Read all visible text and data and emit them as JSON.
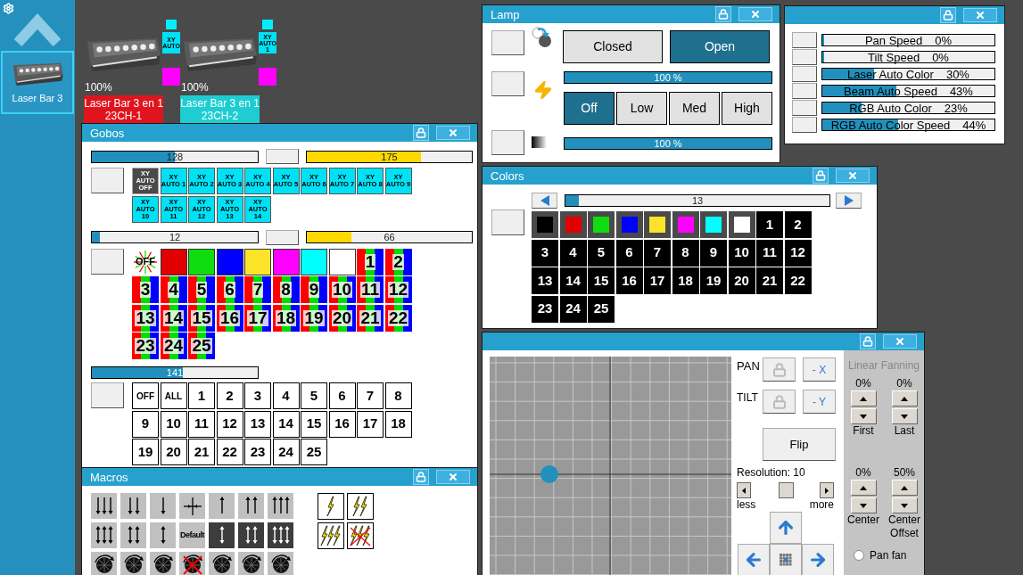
{
  "sidebar": {
    "items": [
      {
        "label": "Laser Bar 3",
        "selected": true
      }
    ]
  },
  "stage": {
    "fixtures": [
      {
        "name": "Laser Bar 3 en 1 23CH-1",
        "reading": "100%",
        "color": "#e0141e",
        "badge": "XY AUTO"
      },
      {
        "name": "Laser Bar 3 en 1 23CH-2",
        "reading": "100%",
        "color": "#1ecdd2",
        "badge": "XY AUTO 1"
      }
    ]
  },
  "gobos": {
    "title": "Gobos",
    "sections": [
      {
        "sliders": [
          {
            "value": "128",
            "level": 0.5,
            "color": "#2190bd"
          },
          {
            "value": "175",
            "level": 0.69,
            "color": "#ffd800"
          }
        ],
        "tiles": [
          {
            "kind": "xy",
            "label": "XY AUTO OFF",
            "selected": true
          },
          {
            "kind": "xy",
            "label": "XY AUTO 1",
            "selected": false
          },
          {
            "kind": "xy",
            "label": "XY AUTO 2",
            "selected": false
          },
          {
            "kind": "xy",
            "label": "XY AUTO 3",
            "selected": false
          },
          {
            "kind": "xy",
            "label": "XY AUTO 4",
            "selected": false
          },
          {
            "kind": "xy",
            "label": "XY AUTO 5",
            "selected": false
          },
          {
            "kind": "xy",
            "label": "XY AUTO 6",
            "selected": false
          },
          {
            "kind": "xy",
            "label": "XY AUTO 7",
            "selected": false
          },
          {
            "kind": "xy",
            "label": "XY AUTO 8",
            "selected": false
          },
          {
            "kind": "xy",
            "label": "XY AUTO 9",
            "selected": false
          },
          {
            "kind": "xy",
            "label": "XY AUTO 10",
            "selected": false
          },
          {
            "kind": "xy",
            "label": "XY AUTO 11",
            "selected": false
          },
          {
            "kind": "xy",
            "label": "XY AUTO 12",
            "selected": false
          },
          {
            "kind": "xy",
            "label": "XY AUTO 13",
            "selected": false
          },
          {
            "kind": "xy",
            "label": "XY AUTO 14",
            "selected": false
          }
        ]
      },
      {
        "sliders": [
          {
            "value": "12",
            "level": 0.05,
            "color": "#2190bd"
          },
          {
            "value": "66",
            "level": 0.27,
            "color": "#ffd800"
          }
        ],
        "tiles": [
          {
            "kind": "off",
            "label": "OFF"
          },
          {
            "kind": "color",
            "color": "#e00000"
          },
          {
            "kind": "color",
            "color": "#10dd10"
          },
          {
            "kind": "color",
            "color": "#0000ff"
          },
          {
            "kind": "color",
            "color": "#fce42a"
          },
          {
            "kind": "color",
            "color": "#ff00ff"
          },
          {
            "kind": "color",
            "color": "#00ffff"
          },
          {
            "kind": "color",
            "color": "#ffffff"
          },
          {
            "kind": "number",
            "label": "1"
          },
          {
            "kind": "number",
            "label": "2"
          },
          {
            "kind": "number",
            "label": "3"
          },
          {
            "kind": "number",
            "label": "4"
          },
          {
            "kind": "number",
            "label": "5"
          },
          {
            "kind": "number",
            "label": "6"
          },
          {
            "kind": "number",
            "label": "7"
          },
          {
            "kind": "number",
            "label": "8"
          },
          {
            "kind": "number",
            "label": "9"
          },
          {
            "kind": "number",
            "label": "10"
          },
          {
            "kind": "number",
            "label": "11"
          },
          {
            "kind": "number",
            "label": "12"
          },
          {
            "kind": "number",
            "label": "13"
          },
          {
            "kind": "number",
            "label": "14"
          },
          {
            "kind": "number",
            "label": "15"
          },
          {
            "kind": "number",
            "label": "16"
          },
          {
            "kind": "number",
            "label": "17"
          },
          {
            "kind": "number",
            "label": "18"
          },
          {
            "kind": "number",
            "label": "19"
          },
          {
            "kind": "number",
            "label": "20"
          },
          {
            "kind": "number",
            "label": "21"
          },
          {
            "kind": "number",
            "label": "22"
          },
          {
            "kind": "number",
            "label": "23"
          },
          {
            "kind": "number",
            "label": "24"
          },
          {
            "kind": "number",
            "label": "25"
          }
        ]
      },
      {
        "sliders": [
          {
            "value": "141",
            "level": 0.55,
            "color": "#2190bd"
          }
        ],
        "tiles": [
          {
            "kind": "plain",
            "label": "OFF"
          },
          {
            "kind": "plain",
            "label": "ALL"
          },
          {
            "kind": "plain",
            "label": "1"
          },
          {
            "kind": "plain",
            "label": "2"
          },
          {
            "kind": "plain",
            "label": "3"
          },
          {
            "kind": "plain",
            "label": "4"
          },
          {
            "kind": "plain",
            "label": "5"
          },
          {
            "kind": "plain",
            "label": "6"
          },
          {
            "kind": "plain",
            "label": "7"
          },
          {
            "kind": "plain",
            "label": "8"
          },
          {
            "kind": "plain",
            "label": "9"
          },
          {
            "kind": "plain",
            "label": "10"
          },
          {
            "kind": "plain",
            "label": "11"
          },
          {
            "kind": "plain",
            "label": "12"
          },
          {
            "kind": "plain",
            "label": "13"
          },
          {
            "kind": "plain",
            "label": "14"
          },
          {
            "kind": "plain",
            "label": "15"
          },
          {
            "kind": "plain",
            "label": "16"
          },
          {
            "kind": "plain",
            "label": "17"
          },
          {
            "kind": "plain",
            "label": "18"
          },
          {
            "kind": "plain",
            "label": "19"
          },
          {
            "kind": "plain",
            "label": "20"
          },
          {
            "kind": "plain",
            "label": "21"
          },
          {
            "kind": "plain",
            "label": "22"
          },
          {
            "kind": "plain",
            "label": "23"
          },
          {
            "kind": "plain",
            "label": "24"
          },
          {
            "kind": "plain",
            "label": "25"
          }
        ]
      }
    ]
  },
  "macros": {
    "title": "Macros",
    "buttons": [
      {
        "kind": "down3",
        "selected": false
      },
      {
        "kind": "down2",
        "selected": false
      },
      {
        "kind": "down1",
        "selected": false
      },
      {
        "kind": "center",
        "selected": false
      },
      {
        "kind": "up1",
        "selected": false
      },
      {
        "kind": "up2",
        "selected": false
      },
      {
        "kind": "up3",
        "selected": false
      },
      {
        "kind": "both3",
        "selected": false
      },
      {
        "kind": "both2",
        "selected": false
      },
      {
        "kind": "both1",
        "selected": false
      },
      {
        "kind": "label",
        "label": "Default",
        "selected": false
      },
      {
        "kind": "both1",
        "selected": true
      },
      {
        "kind": "both2",
        "selected": true
      },
      {
        "kind": "both3",
        "selected": true
      },
      {
        "kind": "wheel",
        "selected": false
      },
      {
        "kind": "wheel",
        "selected": false
      },
      {
        "kind": "wheel",
        "selected": false
      },
      {
        "kind": "wheel-off",
        "selected": false
      },
      {
        "kind": "wheel",
        "selected": false
      },
      {
        "kind": "wheel",
        "selected": false
      },
      {
        "kind": "wheel",
        "selected": false
      }
    ],
    "strobes": [
      {
        "kind": "strobe1"
      },
      {
        "kind": "strobe2"
      },
      {
        "kind": "strobe3"
      },
      {
        "kind": "strobe-off"
      }
    ]
  },
  "lamp": {
    "title": "Lamp",
    "shutter": [
      {
        "label": "Closed",
        "selected": false
      },
      {
        "label": "Open",
        "selected": true
      }
    ],
    "dimmer": {
      "value": "100 %",
      "level": 1
    },
    "strobe": [
      {
        "label": "Off",
        "selected": true
      },
      {
        "label": "Low",
        "selected": false
      },
      {
        "label": "Med",
        "selected": false
      },
      {
        "label": "High",
        "selected": false
      }
    ],
    "fade": {
      "value": "100 %",
      "level": 1
    }
  },
  "speeds": {
    "channels": [
      {
        "name": "Pan Speed",
        "value": "0%",
        "level": 0
      },
      {
        "name": "Tilt Speed",
        "value": "0%",
        "level": 0
      },
      {
        "name": "Laser Auto Color",
        "value": "30%",
        "level": 0.3
      },
      {
        "name": "Beam Auto Speed",
        "value": "43%",
        "level": 0.43
      },
      {
        "name": "RGB Auto Color",
        "value": "23%",
        "level": 0.23
      },
      {
        "name": "RGB Auto Color Speed",
        "value": "44%",
        "level": 0.44
      }
    ]
  },
  "colors": {
    "title": "Colors",
    "slider": {
      "value": "13",
      "level": 0.05
    },
    "swatches": [
      {
        "kind": "color",
        "color": "#000000"
      },
      {
        "kind": "color",
        "color": "#e00000"
      },
      {
        "kind": "color",
        "color": "#10dd10"
      },
      {
        "kind": "color",
        "color": "#0000ff"
      },
      {
        "kind": "color",
        "color": "#fce42a"
      },
      {
        "kind": "color",
        "color": "#ff00ff"
      },
      {
        "kind": "color",
        "color": "#00ffff"
      },
      {
        "kind": "color",
        "color": "#ffffff"
      },
      {
        "kind": "number",
        "label": "1"
      },
      {
        "kind": "number",
        "label": "2"
      },
      {
        "kind": "number",
        "label": "3"
      },
      {
        "kind": "number",
        "label": "4"
      },
      {
        "kind": "number",
        "label": "5"
      },
      {
        "kind": "number",
        "label": "6"
      },
      {
        "kind": "number",
        "label": "7"
      },
      {
        "kind": "number",
        "label": "8"
      },
      {
        "kind": "number",
        "label": "9"
      },
      {
        "kind": "number",
        "label": "10"
      },
      {
        "kind": "number",
        "label": "11"
      },
      {
        "kind": "number",
        "label": "12"
      },
      {
        "kind": "number",
        "label": "13"
      },
      {
        "kind": "number",
        "label": "14"
      },
      {
        "kind": "number",
        "label": "15"
      },
      {
        "kind": "number",
        "label": "16"
      },
      {
        "kind": "number",
        "label": "17"
      },
      {
        "kind": "number",
        "label": "18"
      },
      {
        "kind": "number",
        "label": "19"
      },
      {
        "kind": "number",
        "label": "20"
      },
      {
        "kind": "number",
        "label": "21"
      },
      {
        "kind": "number",
        "label": "22"
      },
      {
        "kind": "number",
        "label": "23"
      },
      {
        "kind": "number",
        "label": "24"
      },
      {
        "kind": "number",
        "label": "25"
      }
    ]
  },
  "position": {
    "pan_label": "PAN",
    "tilt_label": "TILT",
    "invert_x": "- X",
    "invert_y": "- Y",
    "flip": "Flip",
    "resolution": {
      "label": "Resolution: 10",
      "level": 0.5,
      "less": "less",
      "more": "more"
    },
    "fanning": {
      "title": "Linear Fanning",
      "controls": [
        {
          "value": "0%",
          "label": "First"
        },
        {
          "value": "0%",
          "label": "Last"
        },
        {
          "value": "0%",
          "label": "Center"
        },
        {
          "value": "50%",
          "label": "Center Offset"
        }
      ],
      "radio": {
        "label": "Pan fan",
        "checked": false
      }
    }
  }
}
